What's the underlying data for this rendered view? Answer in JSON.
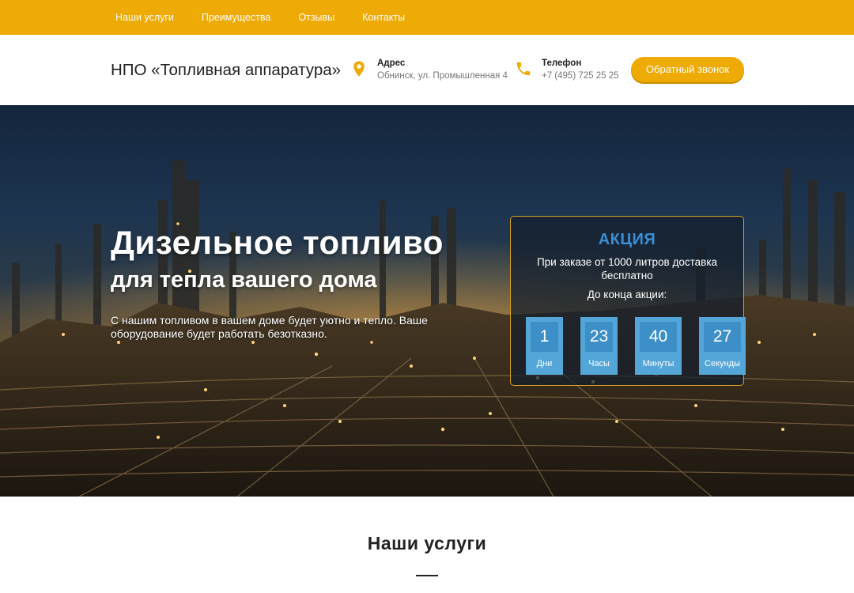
{
  "nav": {
    "items": [
      "Наши услуги",
      "Преимущества",
      "Отзывы",
      "Контакты"
    ]
  },
  "header": {
    "brand": "НПО «Топливная аппаратура»",
    "address": {
      "label": "Адрес",
      "value": "Обнинск, ул. Промышленная 4",
      "icon": "map-pin-icon"
    },
    "phone": {
      "label": "Телефон",
      "value": "+7 (495) 725 25 25",
      "icon": "phone-icon"
    },
    "callback_button": "Обратный звонок"
  },
  "hero": {
    "title": "Дизельное топливо",
    "subtitle": "для тепла вашего дома",
    "description": "С нашим топливом в вашем доме будет уютно и тепло. Ваше оборудование будет работать безотказно."
  },
  "promo": {
    "title": "АКЦИЯ",
    "text": "При заказе от 1000 литров доставка бесплатно",
    "until_label": "До конца акции:",
    "timer": [
      {
        "value": "1",
        "unit": "Дни"
      },
      {
        "value": "23",
        "unit": "Часы"
      },
      {
        "value": "40",
        "unit": "Минуты"
      },
      {
        "value": "27",
        "unit": "Секунды"
      }
    ]
  },
  "services": {
    "title": "Наши услуги"
  },
  "colors": {
    "accent": "#eeaa05",
    "promo_title": "#3b8fd6",
    "timer_box": "#55a6d8",
    "timer_inner": "#3d8fc8"
  }
}
